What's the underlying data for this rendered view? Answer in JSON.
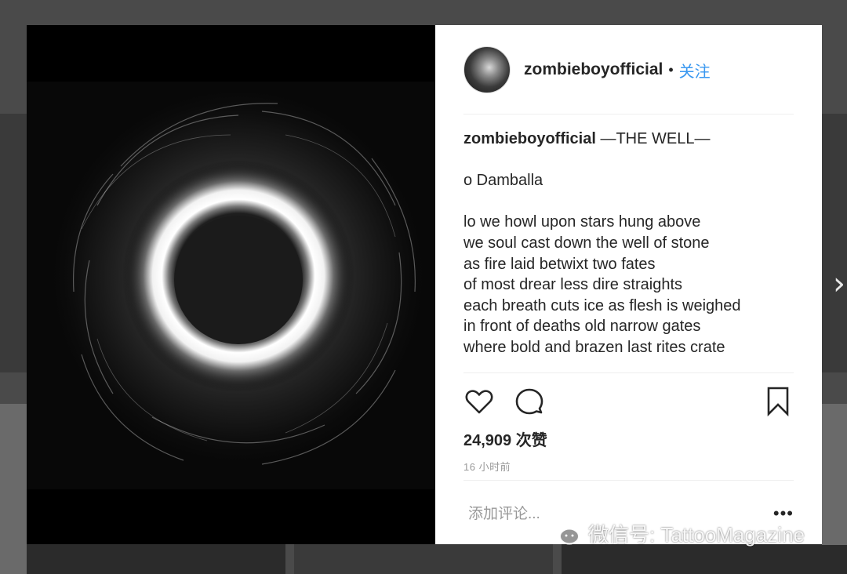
{
  "post": {
    "username": "zombieboyofficial",
    "separator": "•",
    "follow_label": "关注",
    "caption": {
      "title": "—THE WELL—",
      "lines": [
        "o Damballa",
        "",
        "lo we howl upon stars hung above",
        "we soul cast down the well of stone",
        "as fire laid betwixt two fates",
        "of most drear less dire straights",
        "each breath cuts ice as flesh is weighed",
        "in front of deaths old narrow gates",
        "where bold and brazen last rites crate"
      ]
    },
    "likes": "24,909 次赞",
    "time_ago": "16 小时前",
    "comment_placeholder": "添加评论...",
    "more_label": "•••"
  },
  "navigation": {
    "next_arrow": "›"
  },
  "watermark": {
    "text": "微信号: TattooMagazine"
  },
  "icons": {
    "like": "heart-icon",
    "comment": "comment-bubble-icon",
    "save": "bookmark-icon",
    "watermark_logo": "wechat-icon"
  },
  "colors": {
    "follow": "#3897f0",
    "text": "#262626",
    "muted": "#999999",
    "backdrop": "#4a4a4a"
  }
}
